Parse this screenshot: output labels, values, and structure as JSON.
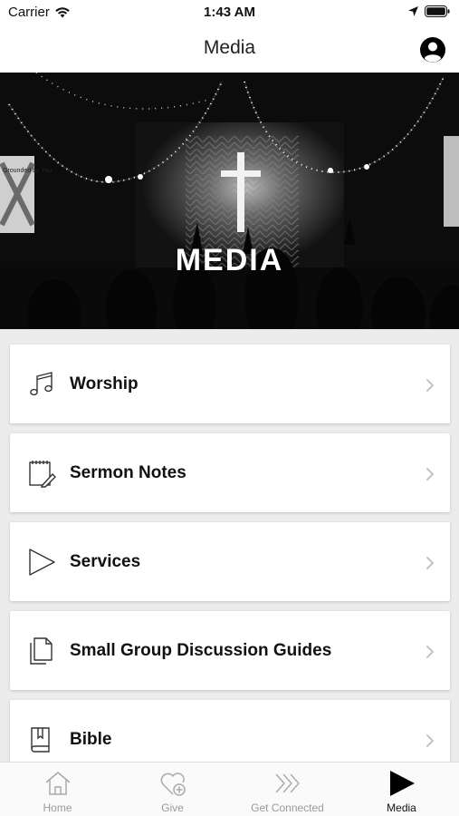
{
  "status_bar": {
    "carrier": "Carrier",
    "time": "1:43 AM"
  },
  "nav": {
    "title": "Media"
  },
  "hero": {
    "title": "MEDIA",
    "banner_text": "Grounded by You"
  },
  "menu": {
    "items": [
      {
        "label": "Worship",
        "icon": "music-note-icon"
      },
      {
        "label": "Sermon Notes",
        "icon": "notepad-pencil-icon"
      },
      {
        "label": "Services",
        "icon": "play-outline-icon"
      },
      {
        "label": "Small Group Discussion Guides",
        "icon": "documents-icon"
      },
      {
        "label": "Bible",
        "icon": "bible-book-icon"
      }
    ]
  },
  "tab_bar": {
    "tabs": [
      {
        "label": "Home",
        "icon": "home-icon",
        "active": false
      },
      {
        "label": "Give",
        "icon": "heart-plus-icon",
        "active": false
      },
      {
        "label": "Get Connected",
        "icon": "double-chevron-icon",
        "active": false
      },
      {
        "label": "Media",
        "icon": "play-filled-icon",
        "active": true
      }
    ]
  },
  "colors": {
    "active_tab": "#111111",
    "inactive_tab": "#999999",
    "background": "#ececec"
  }
}
